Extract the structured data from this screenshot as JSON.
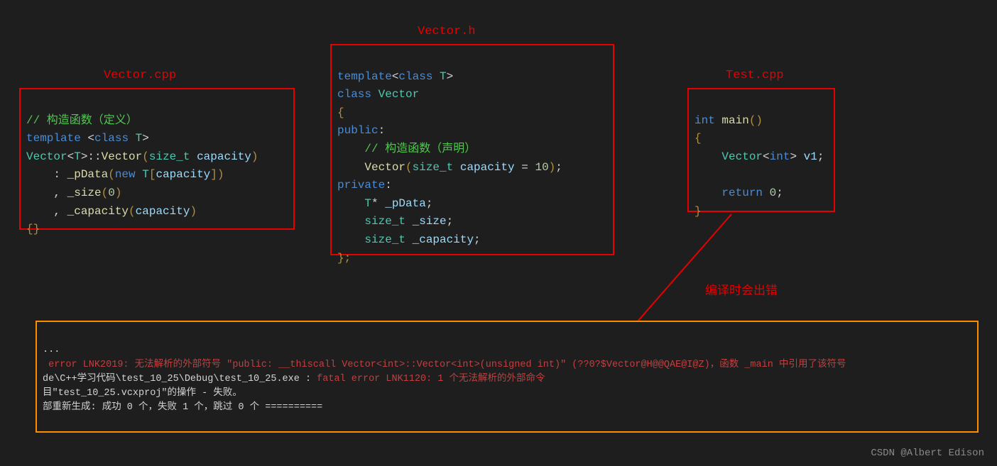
{
  "labels": {
    "vector_cpp": "Vector.cpp",
    "vector_h": "Vector.h",
    "test_cpp": "Test.cpp"
  },
  "annotation": "编译时会出错",
  "vector_cpp": {
    "c1": "// 构造函数（定义）",
    "l2a": "template",
    "l2b": "<",
    "l2c": "class",
    "l2d": "T",
    "l2e": ">",
    "l3a": "Vector",
    "l3b": "<",
    "l3c": "T",
    "l3d": ">::",
    "l3e": "Vector",
    "l3f": "(",
    "l3g": "size_t",
    "l3h": "capacity",
    "l3i": ")",
    "l4a": ": ",
    "l4b": "_pData",
    "l4c": "(",
    "l4d": "new",
    "l4e": "T",
    "l4f": "[",
    "l4g": "capacity",
    "l4h": "]",
    "l4i": ")",
    "l5a": ", ",
    "l5b": "_size",
    "l5c": "(",
    "l5d": "0",
    "l5e": ")",
    "l6a": ", ",
    "l6b": "_capacity",
    "l6c": "(",
    "l6d": "capacity",
    "l6e": ")",
    "l7a": "{}",
    "l7b": ""
  },
  "vector_h": {
    "l1a": "template",
    "l1b": "<",
    "l1c": "class",
    "l1d": "T",
    "l1e": ">",
    "l2a": "class",
    "l2b": "Vector",
    "l3a": "{",
    "l4a": "public",
    "l4b": ":",
    "c5": "    // 构造函数（声明）",
    "l6a": "Vector",
    "l6b": "(",
    "l6c": "size_t",
    "l6d": "capacity",
    "l6e": " = ",
    "l6f": "10",
    "l6g": ")",
    "l6h": ";",
    "l7a": "private",
    "l7b": ":",
    "l8a": "T",
    "l8b": "* ",
    "l8c": "_pData",
    "l8d": ";",
    "l9a": "size_t",
    "l9b": "_size",
    "l9c": ";",
    "l10a": "size_t",
    "l10b": "_capacity",
    "l10c": ";",
    "l11a": "};",
    "l11b": ""
  },
  "test_cpp": {
    "l1a": "int",
    "l1b": "main",
    "l1c": "()",
    "l2a": "{",
    "l3a": "Vector",
    "l3b": "<",
    "l3c": "int",
    "l3d": "> ",
    "l3e": "v1",
    "l3f": ";",
    "l4blank": " ",
    "l5a": "return",
    "l5b": "0",
    "l5c": ";",
    "l6a": "}"
  },
  "errors": {
    "e1": "...",
    "e2": " error LNK2019: 无法解析的外部符号 \"public: __thiscall Vector<int>::Vector<int>(unsigned int)\" (??0?$Vector@H@@QAE@I@Z)，函数 _main 中引用了该符号",
    "e3": "de\\C++学习代码\\test_10_25\\Debug\\test_10_25.exe : fatal error LNK1120: 1 个无法解析的外部命令",
    "e4": "目\"test_10_25.vcxproj\"的操作 - 失败。",
    "e5": "部重新生成: 成功 0 个，失败 1 个，跳过 0 个 =========="
  },
  "watermark": "CSDN @Albert Edison"
}
